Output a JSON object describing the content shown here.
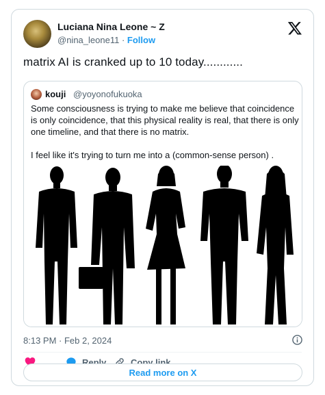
{
  "author": {
    "display_name": "Luciana Nina Leone ~ Z",
    "handle": "@nina_leone11",
    "separator": "·",
    "follow_label": "Follow"
  },
  "tweet": {
    "text": "matrix AI is cranked up to 10 today............",
    "timestamp": "8:13 PM · Feb 2, 2024"
  },
  "quote": {
    "display_name": "kouji",
    "handle": "@yoyonofukuoka",
    "paragraph1": "Some consciousness is trying to make me believe that coincidence is only coincidence, that this physical reality is real, that there is only one timeline, and that there is no matrix.",
    "paragraph2": "I feel like it's trying to turn me into a (common-sense person) .",
    "image_icon": "business-silhouettes-image"
  },
  "actions": {
    "like_icon": "heart-icon",
    "reply_label": "Reply",
    "copy_label": "Copy link"
  },
  "read_more_label": "Read more on X",
  "colors": {
    "accent": "#1d9bf0",
    "like": "#f91880",
    "text": "#0f1419",
    "muted": "#536471",
    "border": "#cfd9de"
  }
}
